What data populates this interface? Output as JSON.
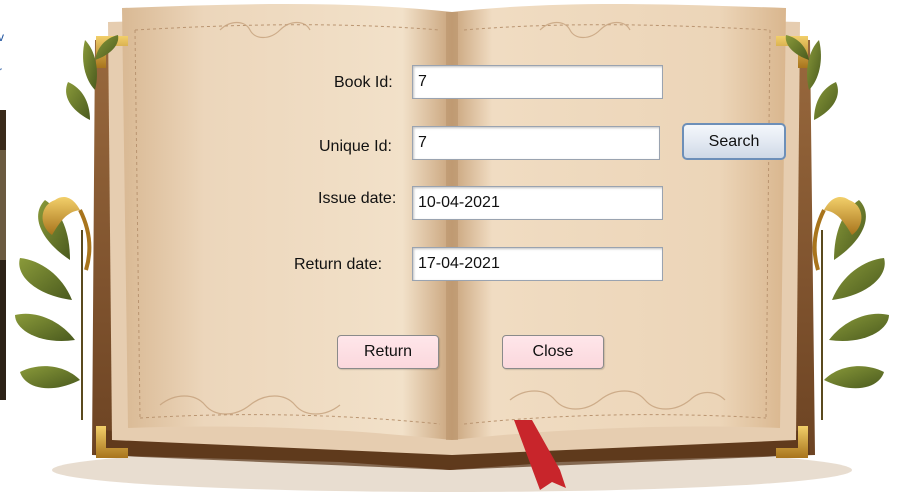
{
  "form": {
    "book_id": {
      "label": "Book Id:",
      "value": "7"
    },
    "unique_id": {
      "label": "Unique Id:",
      "value": "7"
    },
    "issue_date": {
      "label": "Issue date:",
      "value": "10-04-2021"
    },
    "return_date": {
      "label": "Return date:",
      "value": "17-04-2021"
    }
  },
  "buttons": {
    "search": "Search",
    "return": "Return",
    "close": "Close"
  },
  "colors": {
    "page": "#ecd6bb",
    "cover": "#8a5a32",
    "ribbon": "#c8252b",
    "button_pink": "#fbd8dd",
    "button_blue_border": "#6d8fb8"
  },
  "icons": {
    "decor_left": "leaf-ribbon-ornament",
    "decor_right": "leaf-ribbon-ornament",
    "bookmark": "red-ribbon-bookmark"
  }
}
